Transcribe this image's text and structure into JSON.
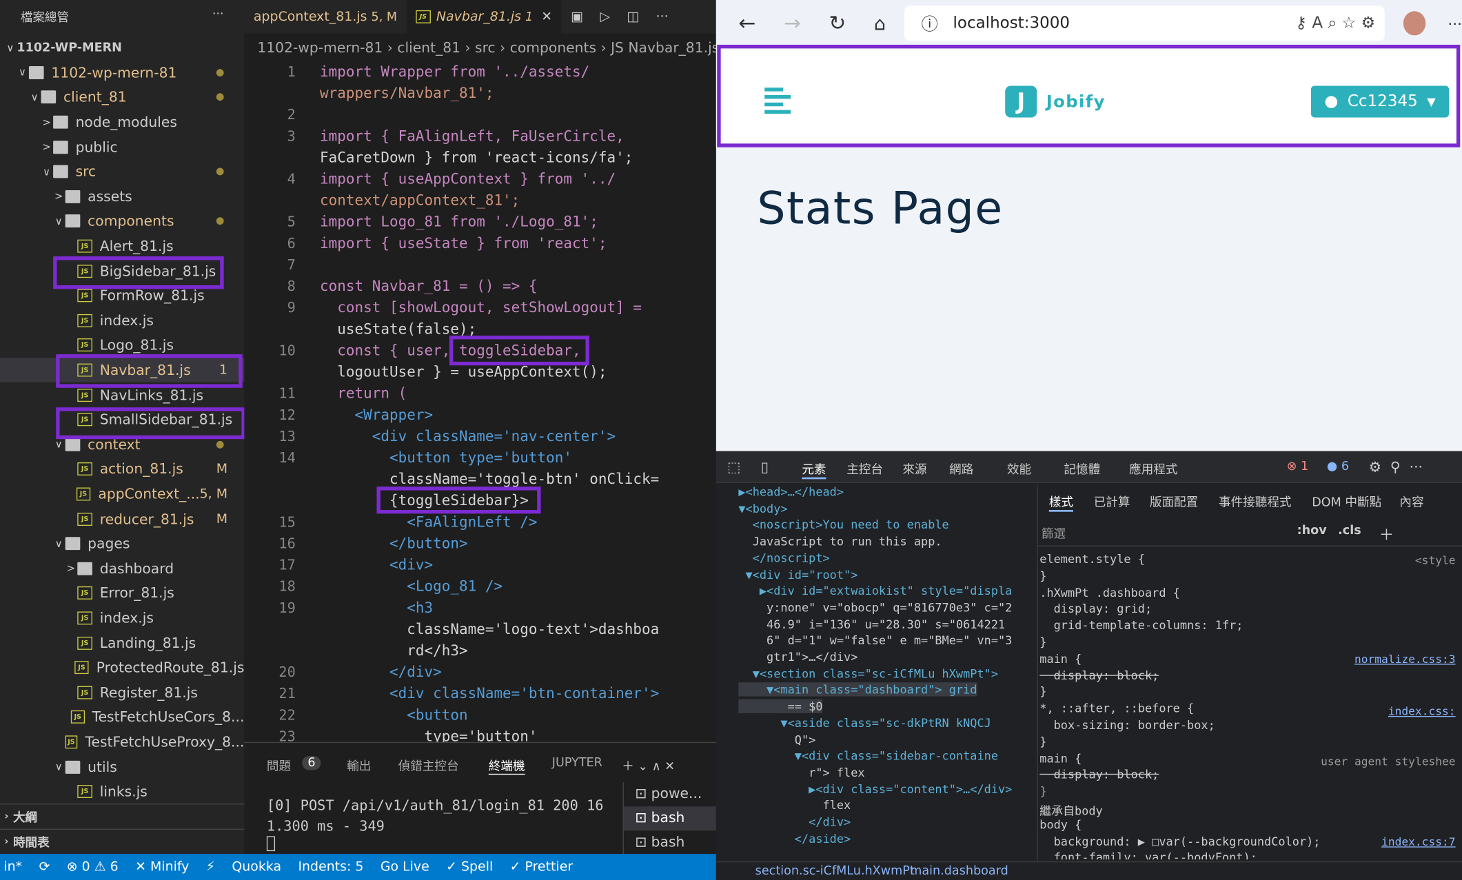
{
  "explorer": {
    "title": "檔案總管",
    "more": "···",
    "outline": "大綱",
    "timeline": "時間表",
    "items": [
      {
        "label": "1102-WP-MERN",
        "chev": "∨",
        "kind": "root"
      },
      {
        "label": "1102-wp-mern-81",
        "chev": "∨",
        "kind": "folder",
        "mod": true,
        "dot": true
      },
      {
        "label": "client_81",
        "chev": "∨",
        "kind": "folder",
        "mod": true,
        "dot": true
      },
      {
        "label": "node_modules",
        "chev": ">",
        "kind": "folder"
      },
      {
        "label": "public",
        "chev": ">",
        "kind": "folder"
      },
      {
        "label": "src",
        "chev": "∨",
        "kind": "folder",
        "mod": true,
        "dot": true
      },
      {
        "label": "assets",
        "chev": ">",
        "kind": "folder"
      },
      {
        "label": "components",
        "chev": "∨",
        "kind": "folder",
        "mod": true,
        "dot": true
      },
      {
        "label": "Alert_81.js",
        "kind": "js"
      },
      {
        "label": "BigSidebar_81.js",
        "kind": "js"
      },
      {
        "label": "FormRow_81.js",
        "kind": "js"
      },
      {
        "label": "index.js",
        "kind": "js"
      },
      {
        "label": "Logo_81.js",
        "kind": "js"
      },
      {
        "label": "Navbar_81.js",
        "kind": "js",
        "mod": true,
        "badge": "1",
        "selected": true
      },
      {
        "label": "NavLinks_81.js",
        "kind": "js"
      },
      {
        "label": "SmallSidebar_81.js",
        "kind": "js"
      },
      {
        "label": "context",
        "chev": "∨",
        "kind": "folder",
        "mod": true,
        "dot": true
      },
      {
        "label": "action_81.js",
        "kind": "js",
        "mod": true,
        "badge": "M"
      },
      {
        "label": "appContext_...",
        "kind": "js",
        "mod": true,
        "badge": "5, M"
      },
      {
        "label": "reducer_81.js",
        "kind": "js",
        "mod": true,
        "badge": "M"
      },
      {
        "label": "pages",
        "chev": "∨",
        "kind": "folder"
      },
      {
        "label": "dashboard",
        "chev": ">",
        "kind": "folder"
      },
      {
        "label": "Error_81.js",
        "kind": "js"
      },
      {
        "label": "index.js",
        "kind": "js"
      },
      {
        "label": "Landing_81.js",
        "kind": "js"
      },
      {
        "label": "ProtectedRoute_81.js",
        "kind": "js"
      },
      {
        "label": "Register_81.js",
        "kind": "js"
      },
      {
        "label": "TestFetchUseCors_8...",
        "kind": "js"
      },
      {
        "label": "TestFetchUseProxy_8...",
        "kind": "js"
      },
      {
        "label": "utils",
        "chev": "∨",
        "kind": "folder"
      },
      {
        "label": "links.js",
        "kind": "js"
      }
    ]
  },
  "editor": {
    "tab1": "appContext_81.js",
    "tab1_badge": "5, M",
    "tab2": "Navbar_81.js",
    "tab2_badge": "1",
    "breadcrumb": "1102-wp-mern-81 › client_81 › src › components › JS Navbar_81.js",
    "lines": [
      {
        "n": "1",
        "t": "import Wrapper from '../assets/"
      },
      {
        "n": "",
        "t": "wrappers/Navbar_81';"
      },
      {
        "n": "2",
        "t": ""
      },
      {
        "n": "3",
        "t": "import { FaAlignLeft, FaUserCircle,"
      },
      {
        "n": "",
        "t": "FaCaretDown } from 'react-icons/fa';"
      },
      {
        "n": "4",
        "t": "import { useAppContext } from '../"
      },
      {
        "n": "",
        "t": "context/appContext_81';"
      },
      {
        "n": "5",
        "t": "import Logo_81 from './Logo_81';"
      },
      {
        "n": "6",
        "t": "import { useState } from 'react';"
      },
      {
        "n": "7",
        "t": ""
      },
      {
        "n": "8",
        "t": "const Navbar_81 = () => {"
      },
      {
        "n": "9",
        "t": "  const [showLogout, setShowLogout] ="
      },
      {
        "n": "",
        "t": "  useState(false);"
      },
      {
        "n": "10",
        "t": "  const { user, toggleSidebar,"
      },
      {
        "n": "",
        "t": "  logoutUser } = useAppContext();"
      },
      {
        "n": "11",
        "t": "  return ("
      },
      {
        "n": "12",
        "t": "    <Wrapper>"
      },
      {
        "n": "13",
        "t": "      <div className='nav-center'>"
      },
      {
        "n": "14",
        "t": "        <button type='button'"
      },
      {
        "n": "",
        "t": "        className='toggle-btn' onClick="
      },
      {
        "n": "",
        "t": "        {toggleSidebar}>"
      },
      {
        "n": "15",
        "t": "          <FaAlignLeft />"
      },
      {
        "n": "16",
        "t": "        </button>"
      },
      {
        "n": "17",
        "t": "        <div>"
      },
      {
        "n": "18",
        "t": "          <Logo_81 />"
      },
      {
        "n": "19",
        "t": "          <h3"
      },
      {
        "n": "",
        "t": "          className='logo-text'>dashboa"
      },
      {
        "n": "",
        "t": "          rd</h3>"
      },
      {
        "n": "20",
        "t": "        </div>"
      },
      {
        "n": "21",
        "t": "        <div className='btn-container'>"
      },
      {
        "n": "22",
        "t": "          <button"
      },
      {
        "n": "23",
        "t": "            type='button'"
      }
    ]
  },
  "panel": {
    "tabs": [
      "問題",
      "輸出",
      "偵錯主控台",
      "終端機",
      "JUPYTER"
    ],
    "problems_count": "6",
    "terminal_line1": "[0] POST /api/v1/auth_81/login_81 200 16",
    "terminal_line2": "1.300 ms - 349",
    "shells": [
      "powe...",
      "bash",
      "bash"
    ]
  },
  "status": {
    "items": [
      "in*",
      "⟳",
      "⊗ 0 ⚠ 6",
      "✕ Minify",
      "⚡",
      "Quokka",
      "Indents: 5",
      "Go Live",
      "✓ Spell",
      "✓ Prettier"
    ]
  },
  "browser": {
    "url": "localhost:3000",
    "brand": "Jobify",
    "logo_letter": "J",
    "user_btn": "Cc12345",
    "heading": "Stats Page"
  },
  "devtools": {
    "tabs": [
      "元素",
      "主控台",
      "來源",
      "網路",
      "效能",
      "記憶體",
      "應用程式"
    ],
    "errors": "1",
    "infos": "6",
    "dom_lines": [
      "▶<head>…</head>",
      "▼<body>",
      "  <noscript>You need to enable",
      "  JavaScript to run this app.",
      "  </noscript>",
      " ▼<div id=\"root\">",
      "   ▶<div id=\"extwaiokist\" style=\"displa",
      "    y:none\" v=\"obocp\" q=\"816770e3\" c=\"2",
      "    46.9\" i=\"136\" u=\"28.30\" s=\"0614221",
      "    6\" d=\"1\" w=\"false\" e m=\"BMe=\" vn=\"3",
      "    gtr1\">…</div>",
      "  ▼<section class=\"sc-iCfMLu hXwmPt\">",
      "    ▼<main class=\"dashboard\"> grid",
      "       == $0",
      "      ▼<aside class=\"sc-dkPtRN kNQCJ",
      "        Q\">",
      "        ▼<div class=\"sidebar-containe",
      "          r\"> flex",
      "          ▶<div class=\"content\">…</div>",
      "            flex",
      "          </div>",
      "        </aside>"
    ],
    "styles_tabs": [
      "樣式",
      "已計算",
      "版面配置",
      "事件接聽程式",
      "DOM 中斷點",
      "內容"
    ],
    "filter": "篩選",
    "hov": ":hov",
    "cls": ".cls",
    "rules": [
      "element.style {",
      "}",
      ".hXwmPt .dashboard {",
      "  display: grid;",
      "  grid-template-columns: 1fr;",
      "}",
      "main {",
      "  display: block;",
      "}",
      "*, ::after, ::before {",
      "  box-sizing: border-box;",
      "}",
      "main {",
      "  display: block;",
      "}",
      "繼承自body",
      "body {",
      "  background: ▶ □var(--backgroundColor);",
      "  font-family: var(--bodyFont);"
    ],
    "sources": [
      "<style",
      "normalize.css:3",
      "index.css:",
      "user agent styleshee",
      "index.css:7"
    ],
    "crumbs": [
      "section.sc-iCfMLu.hXwmPt",
      "main.dashboard"
    ]
  }
}
